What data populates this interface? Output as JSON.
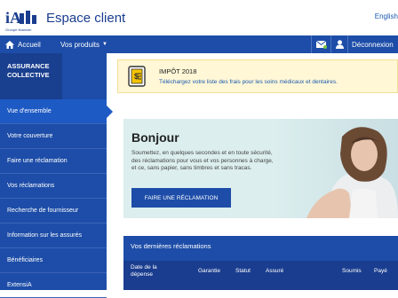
{
  "header": {
    "logo_text": "iA",
    "logo_subtext": "Groupe financier",
    "title": "Espace client",
    "language_link": "English"
  },
  "nav": {
    "home_label": "Accueil",
    "products_label": "Vos produits",
    "logout_label": "Déconnexion"
  },
  "sidebar": {
    "heading": "ASSURANCE COLLECTIVE",
    "items": [
      {
        "label": "Vue d'ensemble",
        "active": true
      },
      {
        "label": "Votre couverture"
      },
      {
        "label": "Faire une réclamation"
      },
      {
        "label": "Vos réclamations"
      },
      {
        "label": "Recherche de fournisseur"
      },
      {
        "label": "Information sur les assurés"
      },
      {
        "label": "Bénéficiaires"
      },
      {
        "label": "ExtensiA"
      }
    ]
  },
  "banner": {
    "title": "IMPÔT 2018",
    "text": "Téléchargez votre liste des frais pour les soins médicaux et dentaires."
  },
  "hero": {
    "title": "Bonjour",
    "text": "Soumettez, en quelques secondes et en toute sécurité, des réclamations pour vous et vos personnes à charge, et ce, sans papier, sans timbres et sans tracas.",
    "button_label": "FAIRE UNE RÉCLAMATION"
  },
  "claims": {
    "title": "Vos dernières réclamations",
    "columns": [
      "Date de la dépense",
      "Garantie",
      "Statut",
      "Assuré",
      "Soumis",
      "Payé"
    ]
  },
  "colors": {
    "brand_blue": "#1d4da8",
    "banner_bg": "#fff7d6",
    "hero_bg": "#dceeee"
  }
}
